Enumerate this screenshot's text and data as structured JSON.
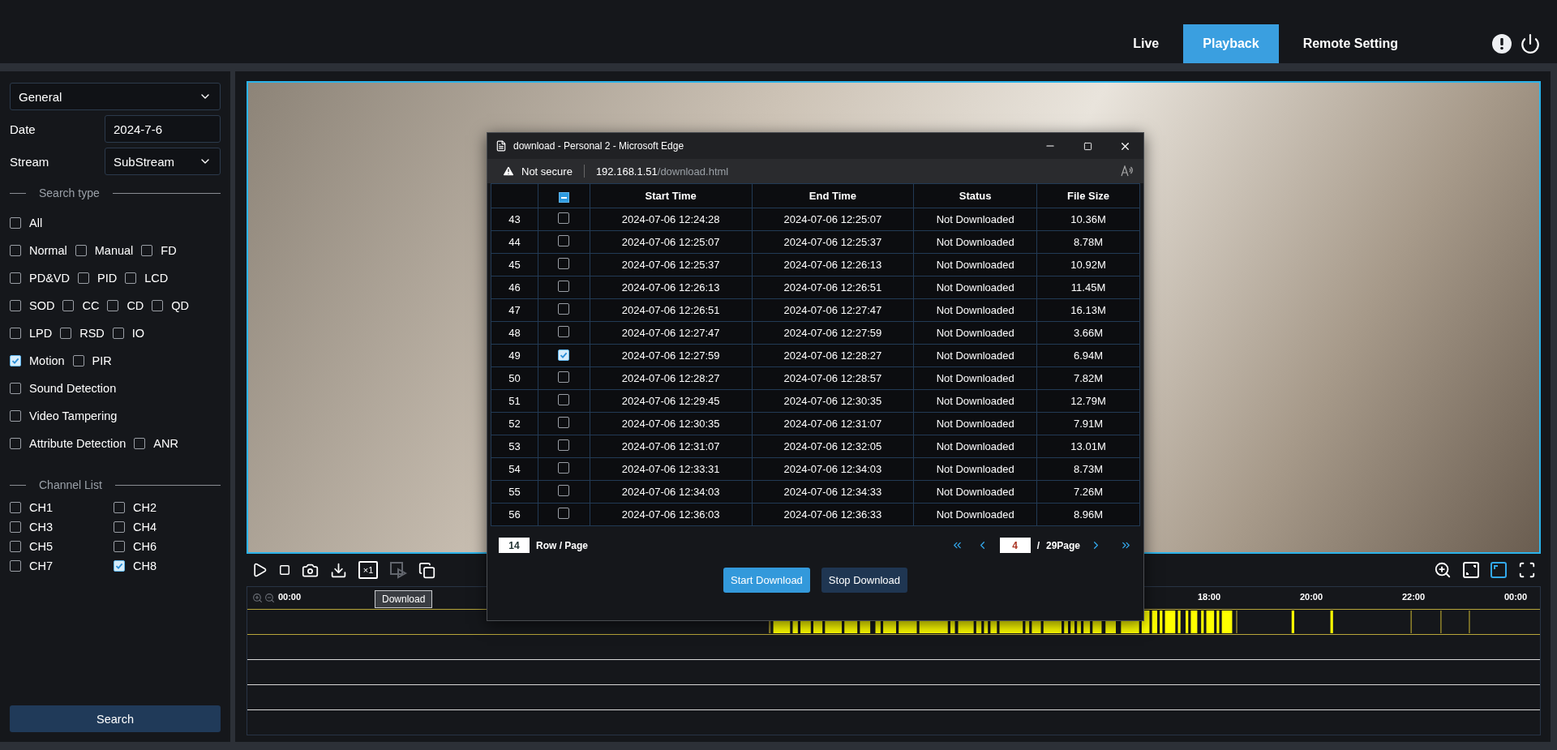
{
  "nav": {
    "tabs": [
      {
        "label": "Live",
        "selected": false
      },
      {
        "label": "Playback",
        "selected": true
      },
      {
        "label": "Remote Setting",
        "selected": false
      }
    ]
  },
  "sidebar": {
    "mode": "General",
    "date_label": "Date",
    "date": "2024-7-6",
    "stream_label": "Stream",
    "stream": "SubStream",
    "search_type_title": "Search type",
    "search_types": [
      [
        {
          "label": "All",
          "checked": false
        }
      ],
      [
        {
          "label": "Normal",
          "checked": false
        },
        {
          "label": "Manual",
          "checked": false
        },
        {
          "label": "FD",
          "checked": false
        }
      ],
      [
        {
          "label": "PD&VD",
          "checked": false
        },
        {
          "label": "PID",
          "checked": false
        },
        {
          "label": "LCD",
          "checked": false
        }
      ],
      [
        {
          "label": "SOD",
          "checked": false
        },
        {
          "label": "CC",
          "checked": false
        },
        {
          "label": "CD",
          "checked": false
        },
        {
          "label": "QD",
          "checked": false
        }
      ],
      [
        {
          "label": "LPD",
          "checked": false
        },
        {
          "label": "RSD",
          "checked": false
        },
        {
          "label": "IO",
          "checked": false
        }
      ],
      [
        {
          "label": "Motion",
          "checked": true
        },
        {
          "label": "PIR",
          "checked": false
        }
      ],
      [
        {
          "label": "Sound Detection",
          "checked": false
        }
      ],
      [
        {
          "label": "Video Tampering",
          "checked": false
        }
      ],
      [
        {
          "label": "Attribute Detection",
          "checked": false
        },
        {
          "label": "ANR",
          "checked": false
        }
      ]
    ],
    "channel_title": "Channel List",
    "channels": [
      {
        "label": "CH1",
        "checked": false
      },
      {
        "label": "CH2",
        "checked": false
      },
      {
        "label": "CH3",
        "checked": false
      },
      {
        "label": "CH4",
        "checked": false
      },
      {
        "label": "CH5",
        "checked": false
      },
      {
        "label": "CH6",
        "checked": false
      },
      {
        "label": "CH7",
        "checked": false
      },
      {
        "label": "CH8",
        "checked": true
      }
    ],
    "search_button": "Search"
  },
  "toolbar": {
    "left": [
      {
        "kind": "play",
        "disabled": false
      },
      {
        "kind": "stop",
        "disabled": false
      },
      {
        "kind": "snapshot",
        "disabled": false
      },
      {
        "kind": "download",
        "disabled": false
      },
      {
        "kind": "speed",
        "label": "×1",
        "disabled": false
      },
      {
        "kind": "clip",
        "disabled": true
      },
      {
        "kind": "windows",
        "disabled": false
      }
    ],
    "right": [
      {
        "kind": "zoom",
        "selected": false
      },
      {
        "kind": "fit",
        "selected": false
      },
      {
        "kind": "ratio",
        "selected": true
      },
      {
        "kind": "fullscreen",
        "selected": false
      }
    ],
    "tooltip": "Download"
  },
  "timeline": {
    "ticks": [
      "00:00",
      "18:00",
      "20:00",
      "22:00",
      "00:00"
    ]
  },
  "popup": {
    "title": "download - Personal 2 - Microsoft Edge",
    "security": "Not secure",
    "url_host": "192.168.1.51",
    "url_path": "/download.html",
    "columns": [
      "Start Time",
      "End Time",
      "Status",
      "File Size"
    ],
    "select_all_partial": true,
    "rows": [
      {
        "index": "43",
        "checked": false,
        "start": "2024-07-06 12:24:28",
        "end": "2024-07-06 12:25:07",
        "status": "Not Downloaded",
        "size": "10.36M"
      },
      {
        "index": "44",
        "checked": false,
        "start": "2024-07-06 12:25:07",
        "end": "2024-07-06 12:25:37",
        "status": "Not Downloaded",
        "size": "8.78M"
      },
      {
        "index": "45",
        "checked": false,
        "start": "2024-07-06 12:25:37",
        "end": "2024-07-06 12:26:13",
        "status": "Not Downloaded",
        "size": "10.92M"
      },
      {
        "index": "46",
        "checked": false,
        "start": "2024-07-06 12:26:13",
        "end": "2024-07-06 12:26:51",
        "status": "Not Downloaded",
        "size": "11.45M"
      },
      {
        "index": "47",
        "checked": false,
        "start": "2024-07-06 12:26:51",
        "end": "2024-07-06 12:27:47",
        "status": "Not Downloaded",
        "size": "16.13M"
      },
      {
        "index": "48",
        "checked": false,
        "start": "2024-07-06 12:27:47",
        "end": "2024-07-06 12:27:59",
        "status": "Not Downloaded",
        "size": "3.66M"
      },
      {
        "index": "49",
        "checked": true,
        "start": "2024-07-06 12:27:59",
        "end": "2024-07-06 12:28:27",
        "status": "Not Downloaded",
        "size": "6.94M"
      },
      {
        "index": "50",
        "checked": false,
        "start": "2024-07-06 12:28:27",
        "end": "2024-07-06 12:28:57",
        "status": "Not Downloaded",
        "size": "7.82M"
      },
      {
        "index": "51",
        "checked": false,
        "start": "2024-07-06 12:29:45",
        "end": "2024-07-06 12:30:35",
        "status": "Not Downloaded",
        "size": "12.79M"
      },
      {
        "index": "52",
        "checked": false,
        "start": "2024-07-06 12:30:35",
        "end": "2024-07-06 12:31:07",
        "status": "Not Downloaded",
        "size": "7.91M"
      },
      {
        "index": "53",
        "checked": false,
        "start": "2024-07-06 12:31:07",
        "end": "2024-07-06 12:32:05",
        "status": "Not Downloaded",
        "size": "13.01M"
      },
      {
        "index": "54",
        "checked": false,
        "start": "2024-07-06 12:33:31",
        "end": "2024-07-06 12:34:03",
        "status": "Not Downloaded",
        "size": "8.73M"
      },
      {
        "index": "55",
        "checked": false,
        "start": "2024-07-06 12:34:03",
        "end": "2024-07-06 12:34:33",
        "status": "Not Downloaded",
        "size": "7.26M"
      },
      {
        "index": "56",
        "checked": false,
        "start": "2024-07-06 12:36:03",
        "end": "2024-07-06 12:36:33",
        "status": "Not Downloaded",
        "size": "8.96M"
      }
    ],
    "rows_per_page": "14",
    "rows_per_page_label": "Row / Page",
    "page": "4",
    "page_sep": "/",
    "page_total": "29Page",
    "start_button": "Start Download",
    "stop_button": "Stop Download"
  }
}
